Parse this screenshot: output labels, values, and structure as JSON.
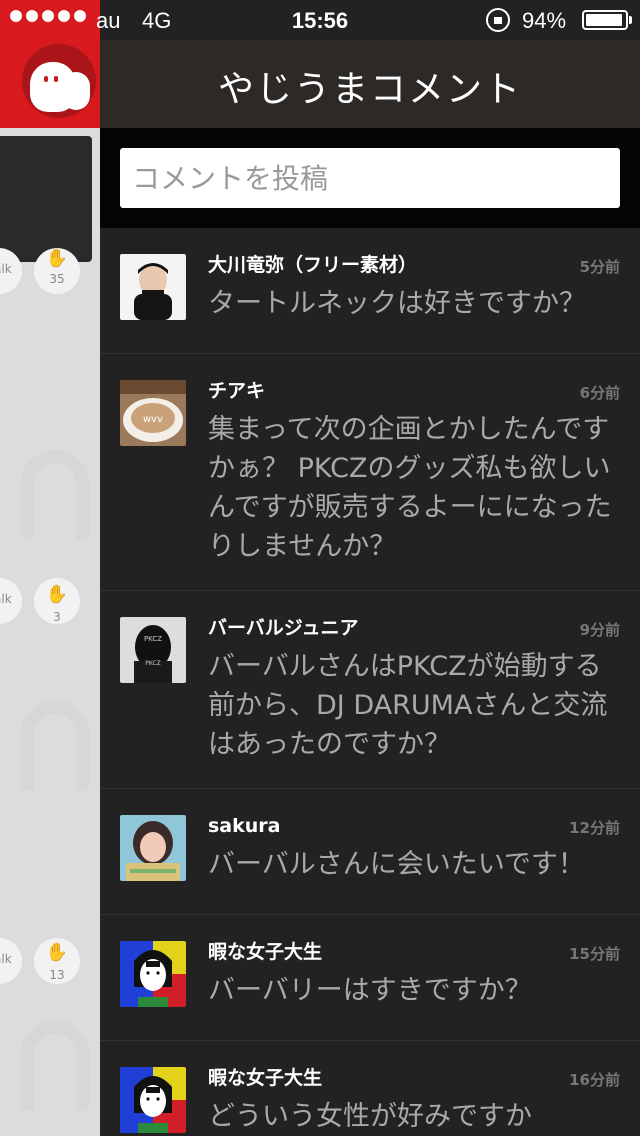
{
  "status_bar": {
    "carrier": "au",
    "network": "4G",
    "time": "15:56",
    "battery": "94%",
    "battery_level": 0.94
  },
  "nav": {
    "title": "やじうまコメント"
  },
  "input": {
    "placeholder": "コメントを投稿"
  },
  "background": {
    "counts": [
      "35",
      "3",
      "13"
    ],
    "talk_label": "alk"
  },
  "comments": [
    {
      "user": "大川竜弥（フリー素材）",
      "ago": "5分前",
      "text": "タートルネックは好きですか？",
      "avatar": "person-black-turtleneck"
    },
    {
      "user": "チアキ",
      "ago": "6分前",
      "text": "集まって次の企画とかしたんですかぁ？ PKCZのグッズ私も欲しいんですが販売するよーにになったりしませんか？",
      "avatar": "latte-art"
    },
    {
      "user": "バーバルジュニア",
      "ago": "9分前",
      "text": "バーバルさんはPKCZが始動する前から、DJ DARUMAさんと交流はあったのですか？",
      "avatar": "masked-figure"
    },
    {
      "user": "sakura",
      "ago": "12分前",
      "text": "バーバルさんに会いたいです！",
      "avatar": "girl-portrait"
    },
    {
      "user": "暇な女子大生",
      "ago": "15分前",
      "text": "バーバリーはすきですか？",
      "avatar": "cartoon-girl"
    },
    {
      "user": "暇な女子大生",
      "ago": "16分前",
      "text": "どういう女性が好みですか",
      "avatar": "cartoon-girl"
    }
  ],
  "colors": {
    "brand_red": "#d8191d",
    "panel_bg": "#222222",
    "nav_bg": "#2c2927"
  }
}
